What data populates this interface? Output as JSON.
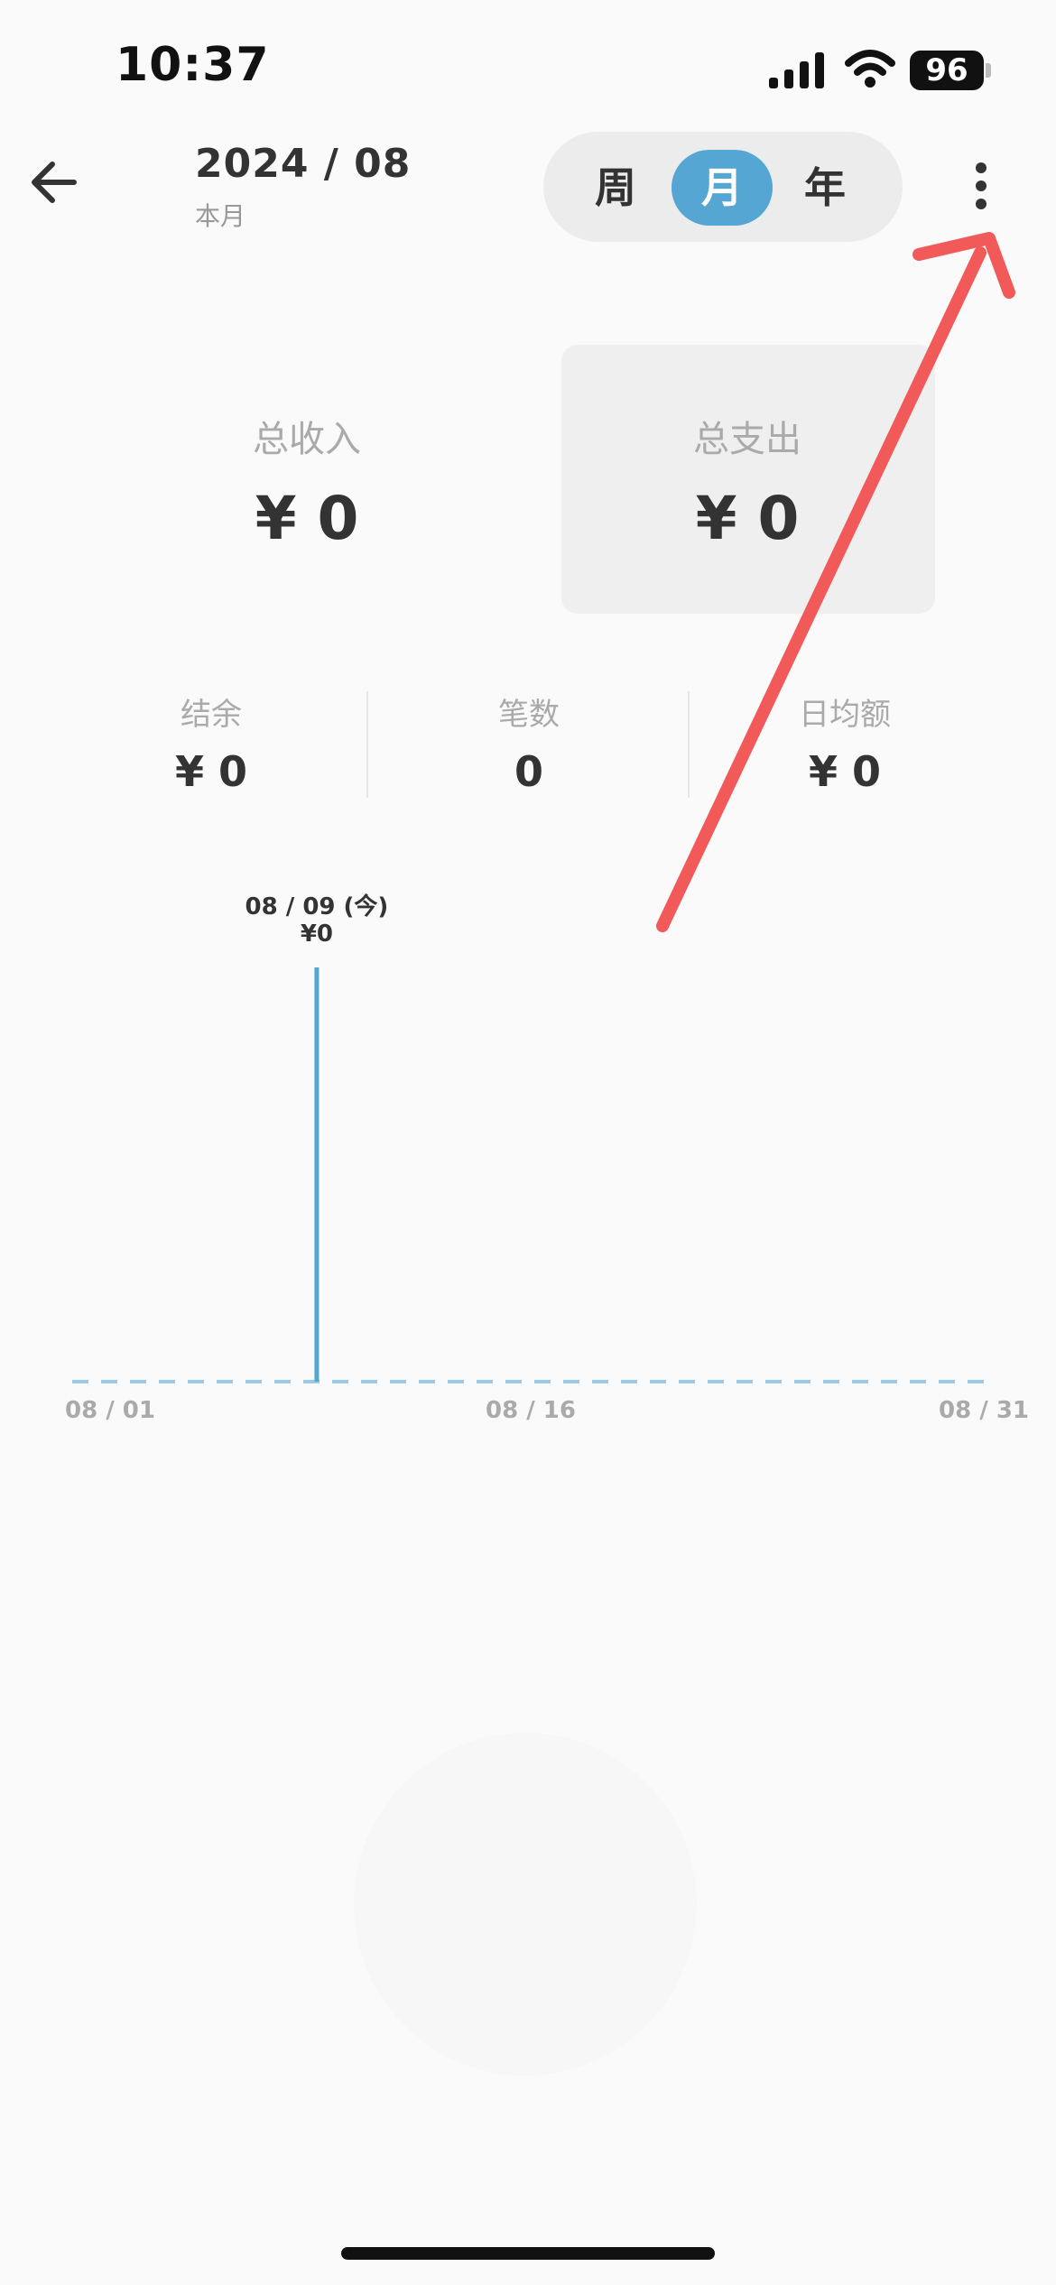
{
  "status_bar": {
    "time": "10:37",
    "battery": "96"
  },
  "header": {
    "title": "2024 / 08",
    "subtitle": "本月",
    "segments": [
      {
        "label": "周",
        "active": false
      },
      {
        "label": "月",
        "active": true
      },
      {
        "label": "年",
        "active": false
      }
    ]
  },
  "totals": {
    "income_label": "总收入",
    "income_value": "¥ 0",
    "expense_label": "总支出",
    "expense_value": "¥ 0"
  },
  "stats": [
    {
      "label": "结余",
      "value": "¥ 0"
    },
    {
      "label": "笔数",
      "value": "0"
    },
    {
      "label": "日均额",
      "value": "¥ 0"
    }
  ],
  "chart_data": {
    "type": "line",
    "x_ticks": [
      "08 / 01",
      "08 / 16",
      "08 / 31"
    ],
    "x": [
      "08/01",
      "08/02",
      "08/03",
      "08/04",
      "08/05",
      "08/06",
      "08/07",
      "08/08",
      "08/09",
      "08/10",
      "08/11",
      "08/12",
      "08/13",
      "08/14",
      "08/15",
      "08/16",
      "08/17",
      "08/18",
      "08/19",
      "08/20",
      "08/21",
      "08/22",
      "08/23",
      "08/24",
      "08/25",
      "08/26",
      "08/27",
      "08/28",
      "08/29",
      "08/30",
      "08/31"
    ],
    "values": [
      0,
      0,
      0,
      0,
      0,
      0,
      0,
      0,
      0,
      0,
      0,
      0,
      0,
      0,
      0,
      0,
      0,
      0,
      0,
      0,
      0,
      0,
      0,
      0,
      0,
      0,
      0,
      0,
      0,
      0,
      0
    ],
    "highlight_index": 8,
    "highlight_date": "08 / 09 (今)",
    "highlight_value": "¥0"
  },
  "colors": {
    "accent": "#56a6d4",
    "annotation_arrow": "#f25a5a"
  },
  "icons": {
    "back": "arrow-left-icon",
    "more": "more-vertical-icon",
    "signal": "cellular-signal-icon",
    "wifi": "wifi-icon"
  }
}
